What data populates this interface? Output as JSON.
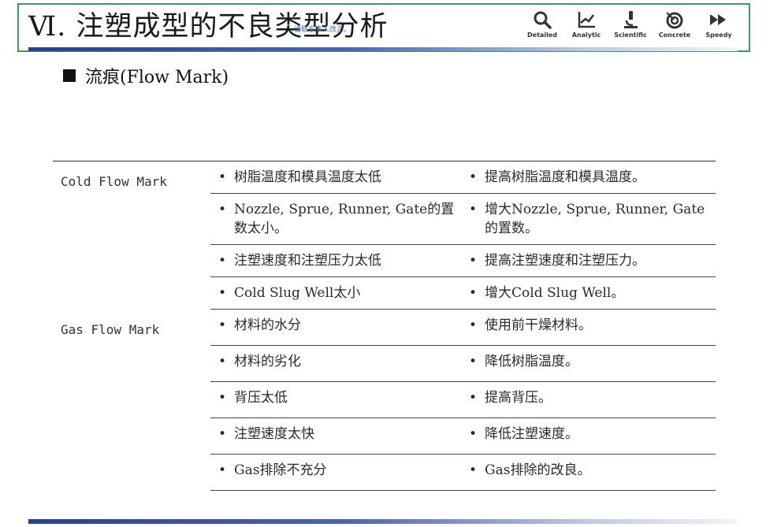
{
  "header": {
    "title": "Ⅵ. 注塑成型的不良类型分析",
    "watermark": "…请联系本人改正。",
    "tools": [
      {
        "icon": "magnifier-icon",
        "label": "Detailed"
      },
      {
        "icon": "line-chart-icon",
        "label": "Analytic"
      },
      {
        "icon": "microscope-icon",
        "label": "Scientific"
      },
      {
        "icon": "target-icon",
        "label": "Concrete"
      },
      {
        "icon": "fast-forward-icon",
        "label": "Speedy"
      }
    ]
  },
  "section": {
    "heading": "流痕(Flow Mark)"
  },
  "table": {
    "groups": [
      {
        "category": "Cold Flow Mark",
        "rows": [
          {
            "cause": "树脂温度和模具温度太低",
            "fix": "提高树脂温度和模具温度。"
          },
          {
            "cause": "Nozzle, Sprue, Runner, Gate的置数太小。",
            "fix": "增大Nozzle, Sprue, Runner, Gate的置数。"
          },
          {
            "cause": "注塑速度和注塑压力太低",
            "fix": "提高注塑速度和注塑压力。"
          },
          {
            "cause": "Cold Slug Well太小",
            "fix": "增大Cold Slug Well。"
          }
        ]
      },
      {
        "category": "Gas Flow Mark",
        "rows": [
          {
            "cause": "材料的水分",
            "fix": "使用前干燥材料。"
          },
          {
            "cause": "材料的劣化",
            "fix": "降低树脂温度。"
          },
          {
            "cause": "背压太低",
            "fix": "提高背压。"
          },
          {
            "cause": "注塑速度太快",
            "fix": "降低注塑速度。"
          },
          {
            "cause": "Gas排除不充分",
            "fix": "Gas排除的改良。"
          }
        ]
      }
    ]
  }
}
